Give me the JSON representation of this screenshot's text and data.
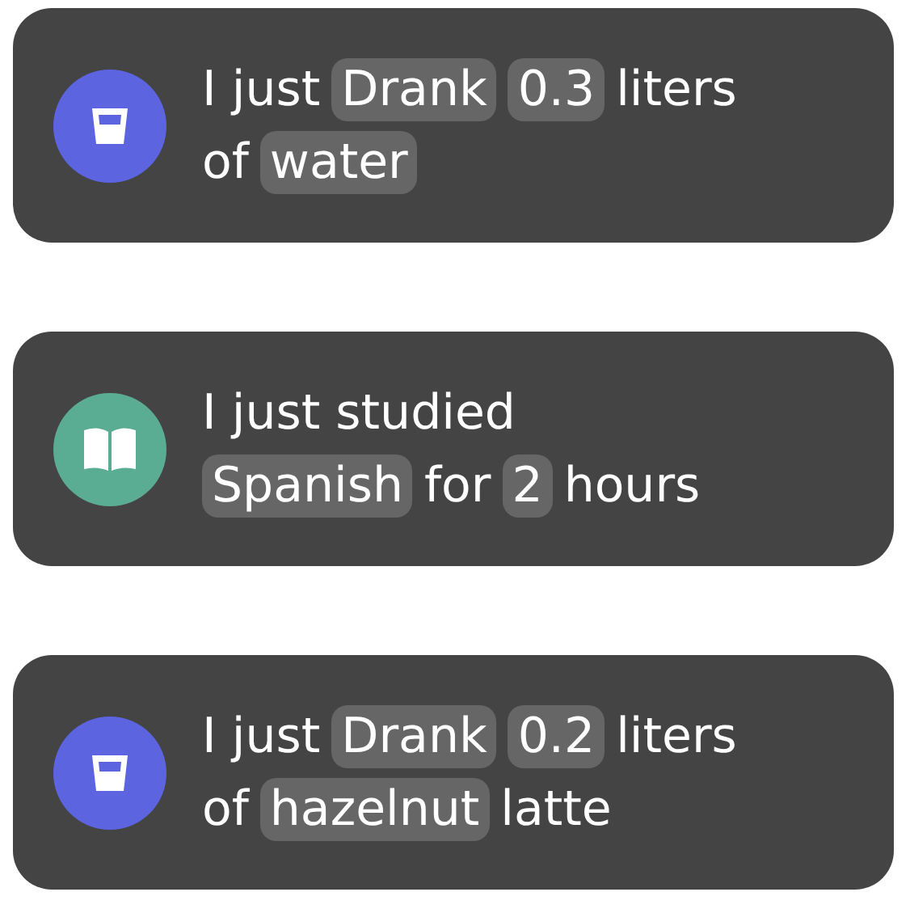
{
  "cards": [
    {
      "kind": "glass",
      "color": "#5c64e0",
      "lines": [
        [
          {
            "text": "I just",
            "kind": "plain"
          },
          {
            "text": "Drank",
            "kind": "chip"
          },
          {
            "text": "0.3",
            "kind": "chip"
          },
          {
            "text": "liters",
            "kind": "plain"
          }
        ],
        [
          {
            "text": "of",
            "kind": "plain"
          },
          {
            "text": "water",
            "kind": "chip"
          }
        ]
      ]
    },
    {
      "kind": "book",
      "color": "#5aad92",
      "lines": [
        [
          {
            "text": "I just studied",
            "kind": "plain"
          }
        ],
        [
          {
            "text": "Spanish",
            "kind": "chip"
          },
          {
            "text": "for",
            "kind": "plain"
          },
          {
            "text": "2",
            "kind": "chip"
          },
          {
            "text": "hours",
            "kind": "plain"
          }
        ]
      ]
    },
    {
      "kind": "glass",
      "color": "#5c64e0",
      "lines": [
        [
          {
            "text": "I just",
            "kind": "plain"
          },
          {
            "text": "Drank",
            "kind": "chip"
          },
          {
            "text": "0.2",
            "kind": "chip"
          },
          {
            "text": "liters",
            "kind": "plain"
          }
        ],
        [
          {
            "text": "of",
            "kind": "plain"
          },
          {
            "text": "hazelnut",
            "kind": "chip"
          },
          {
            "text": "latte",
            "kind": "plain"
          }
        ]
      ]
    }
  ]
}
